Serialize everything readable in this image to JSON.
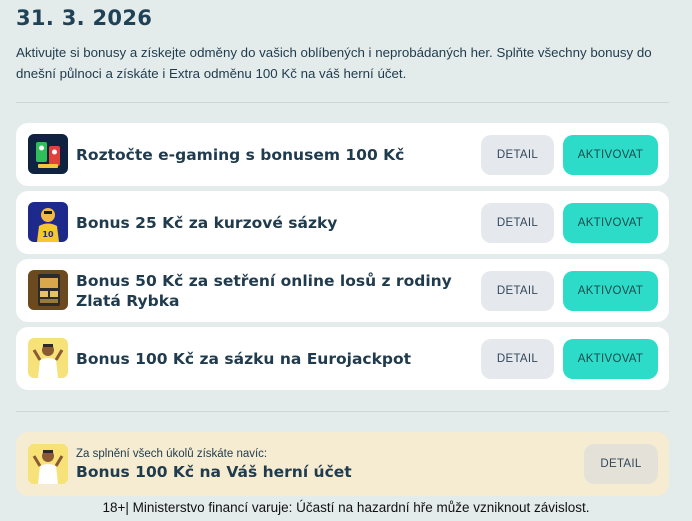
{
  "header": {
    "date": "31. 3. 2026",
    "intro": "Aktivujte si bonusy a získejte odměny do vašich oblíbených i neprobádaných her. Splňte všechny bonusy do dnešní půlnoci a získáte i Extra odměnu 100 Kč na váš herní účet."
  },
  "bonuses": [
    {
      "title": "Roztočte e-gaming s bonusem 100 Kč",
      "detail_label": "DETAIL",
      "activate_label": "AKTIVOVAT",
      "icon": "slot-machine-icon"
    },
    {
      "title": "Bonus 25 Kč za kurzové sázky",
      "detail_label": "DETAIL",
      "activate_label": "AKTIVOVAT",
      "icon": "sports-player-icon"
    },
    {
      "title": "Bonus 50 Kč za setření online losů z rodiny Zlatá Rybka",
      "detail_label": "DETAIL",
      "activate_label": "AKTIVOVAT",
      "icon": "scratch-ticket-icon"
    },
    {
      "title": "Bonus 100 Kč za sázku na Eurojackpot",
      "detail_label": "DETAIL",
      "activate_label": "AKTIVOVAT",
      "icon": "winner-icon"
    }
  ],
  "extra": {
    "subtitle": "Za splnění všech úkolů získáte navíc:",
    "title": "Bonus 100 Kč na Váš herní účet",
    "detail_label": "DETAIL",
    "icon": "winner-icon"
  },
  "footer": {
    "warning": "18+| Ministerstvo financí varuje: Účastí na hazardní hře může vzniknout závislost."
  },
  "colors": {
    "page_bg": "#e3ebeb",
    "card_bg": "#ffffff",
    "accent": "#2ddcc8",
    "detail_bg": "#e5e8ec",
    "extra_bg": "#f6ecd2",
    "text": "#1f3b4d"
  }
}
